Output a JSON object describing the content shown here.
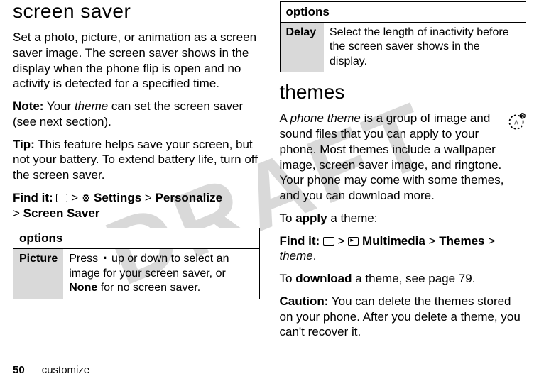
{
  "watermark": "DRAFT",
  "left": {
    "heading": "screen saver",
    "intro": "Set a photo, picture, or animation as a screen saver image. The screen saver shows in the display when the phone flip is open and no activity is detected for a specified time.",
    "note_label": "Note:",
    "note_text_pre": " Your ",
    "note_theme": "theme",
    "note_text_post": " can set the screen saver (see next section).",
    "tip_label": "Tip:",
    "tip_text": " This feature helps save your screen, but not your battery. To extend battery life, turn off the screen saver.",
    "find_it_label": "Find it:",
    "find_it_settings": "Settings",
    "find_it_personalize": "Personalize",
    "find_it_screensaver": "Screen Saver",
    "options_header": "options",
    "row1_label": "Picture",
    "row1_text_1": "Press ",
    "row1_text_2": " up or down to select an image for your screen saver, or ",
    "row1_none": "None",
    "row1_text_3": " for no screen saver."
  },
  "right": {
    "options_header": "options",
    "row1_label": "Delay",
    "row1_text": "Select the length of inactivity before the screen saver shows in the display.",
    "heading": "themes",
    "intro_pre": "A ",
    "intro_theme": "phone theme",
    "intro_post": " is a group of image and sound files that you can apply to your phone. Most themes include a wallpaper image, screen saver image, and ringtone. Your phone may come with some themes, and you can download more.",
    "apply_pre": "To ",
    "apply_bold": "apply",
    "apply_post": " a theme:",
    "find_it_label": "Find it:",
    "find_it_multimedia": "Multimedia",
    "find_it_themes": "Themes",
    "find_it_theme_var": "theme",
    "download_pre": "To ",
    "download_bold": "download",
    "download_post": " a theme, see page 79.",
    "caution_label": "Caution:",
    "caution_text": " You can delete the themes stored on your phone. After you delete a theme, you can't recover it."
  },
  "footer": {
    "page": "50",
    "section": "customize"
  },
  "gt": ">"
}
